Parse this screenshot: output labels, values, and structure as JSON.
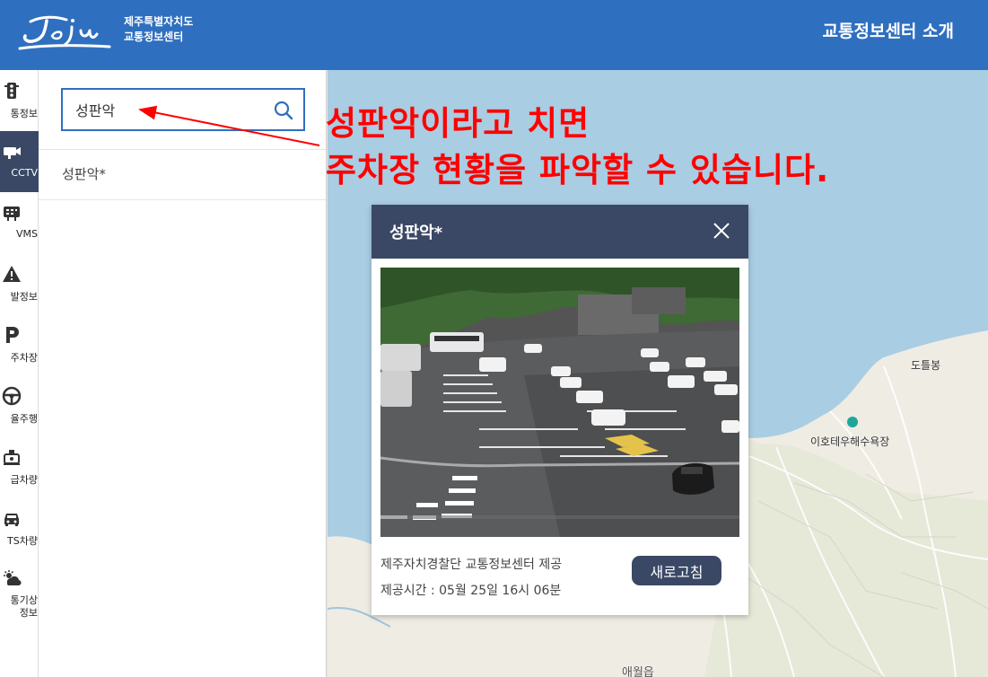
{
  "header": {
    "org_line1": "제주특별자치도",
    "org_line2": "교통정보센터",
    "about_link": "교통정보센터 소개",
    "bg_color": "#2f6fbf"
  },
  "rail": {
    "items": [
      {
        "label": "통정보",
        "icon": "traffic-light-icon"
      },
      {
        "label": "CCTV",
        "icon": "cctv-icon",
        "active": true
      },
      {
        "label": "VMS",
        "icon": "vms-board-icon"
      },
      {
        "label": "발정보",
        "icon": "warning-icon"
      },
      {
        "label": "주차장",
        "icon": "parking-icon"
      },
      {
        "label": "율주행",
        "icon": "steering-wheel-icon"
      },
      {
        "label": "급차량",
        "icon": "emergency-vehicle-icon"
      },
      {
        "label": "TS차량",
        "icon": "car-icon"
      },
      {
        "label": "통기상\n정보",
        "icon": "weather-icon"
      }
    ],
    "active_color": "#3a4866"
  },
  "search": {
    "value": "성판악",
    "button_icon": "search-icon"
  },
  "results": [
    {
      "label": "성판악*"
    }
  ],
  "annotation": {
    "line1": "성판악이라고 치면",
    "line2": "주차장 현황을 파악할 수 있습니다.",
    "color": "#ff0000"
  },
  "popup": {
    "title": "성판악*",
    "provider": "제주자치경찰단 교통정보센터 제공",
    "time": "제공시간 : 05월 25일 16시 06분",
    "refresh_label": "새로고침",
    "header_color": "#3a4866"
  },
  "map": {
    "labels": [
      "도틀봉",
      "이호테우해수욕장",
      "애월읍"
    ]
  }
}
